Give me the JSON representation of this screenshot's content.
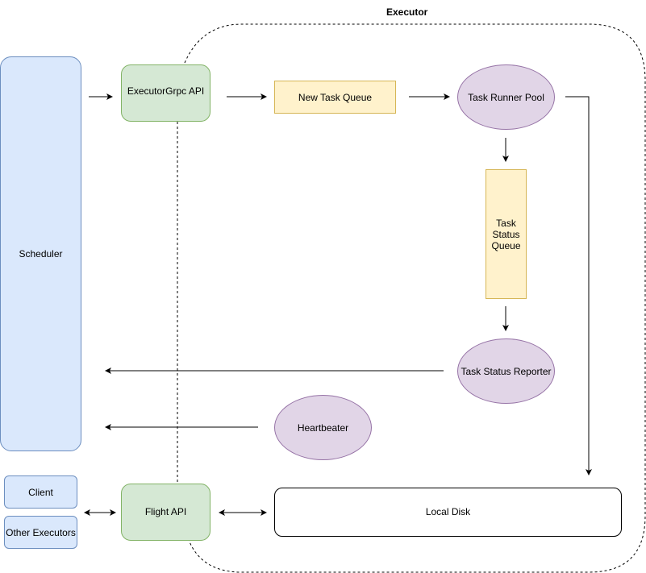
{
  "diagram": {
    "container": {
      "label": "Executor"
    },
    "nodes": {
      "scheduler": "Scheduler",
      "executor_grpc_api": "ExecutorGrpc API",
      "new_task_queue": "New Task Queue",
      "task_runner_pool": "Task Runner Pool",
      "task_status_queue": "Task Status Queue",
      "task_status_reporter": "Task Status Reporter",
      "heartbeater": "Heartbeater",
      "client": "Client",
      "other_executors": "Other Executors",
      "flight_api": "Flight API",
      "local_disk": "Local Disk"
    },
    "edges": [
      {
        "from": "Scheduler",
        "to": "ExecutorGrpc API",
        "direction": "forward"
      },
      {
        "from": "ExecutorGrpc API",
        "to": "New Task Queue",
        "direction": "forward"
      },
      {
        "from": "New Task Queue",
        "to": "Task Runner Pool",
        "direction": "forward"
      },
      {
        "from": "Task Runner Pool",
        "to": "Task Status Queue",
        "direction": "forward"
      },
      {
        "from": "Task Status Queue",
        "to": "Task Status Reporter",
        "direction": "forward"
      },
      {
        "from": "Task Status Reporter",
        "to": "Scheduler",
        "direction": "forward"
      },
      {
        "from": "Heartbeater",
        "to": "Scheduler",
        "direction": "forward"
      },
      {
        "from": "Task Runner Pool",
        "to": "Local Disk",
        "direction": "forward"
      },
      {
        "from": "Client / Other Executors",
        "to": "Flight API",
        "direction": "both"
      },
      {
        "from": "Flight API",
        "to": "Local Disk",
        "direction": "both"
      }
    ],
    "colors": {
      "blue_fill": "#dae8fc",
      "blue_stroke": "#6c8ebf",
      "green_fill": "#d5e8d4",
      "green_stroke": "#82b366",
      "yellow_fill": "#fff2cc",
      "yellow_stroke": "#d6b656",
      "purple_fill": "#e1d5e7",
      "purple_stroke": "#9673a6"
    }
  }
}
